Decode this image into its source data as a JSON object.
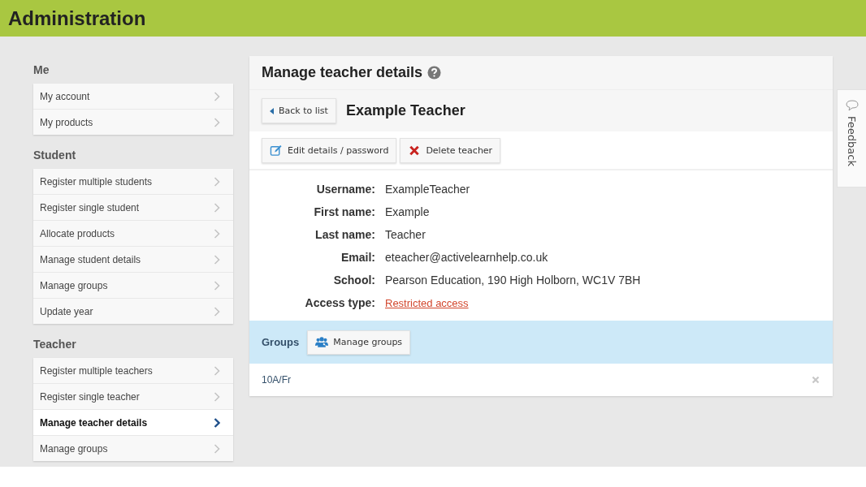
{
  "header": {
    "title": "Administration"
  },
  "sidebar": {
    "sections": [
      {
        "title": "Me",
        "items": [
          {
            "label": "My account",
            "selected": false
          },
          {
            "label": "My products",
            "selected": false
          }
        ]
      },
      {
        "title": "Student",
        "items": [
          {
            "label": "Register multiple students",
            "selected": false
          },
          {
            "label": "Register single student",
            "selected": false
          },
          {
            "label": "Allocate products",
            "selected": false
          },
          {
            "label": "Manage student details",
            "selected": false
          },
          {
            "label": "Manage groups",
            "selected": false
          },
          {
            "label": "Update year",
            "selected": false
          }
        ]
      },
      {
        "title": "Teacher",
        "items": [
          {
            "label": "Register multiple teachers",
            "selected": false
          },
          {
            "label": "Register single teacher",
            "selected": false
          },
          {
            "label": "Manage teacher details",
            "selected": true
          },
          {
            "label": "Manage groups",
            "selected": false
          }
        ]
      }
    ]
  },
  "panel": {
    "title": "Manage teacher details",
    "back_button": "Back to list",
    "teacher_name": "Example Teacher",
    "actions": [
      {
        "kind": "edit",
        "label": "Edit details / password"
      },
      {
        "kind": "delete",
        "label": "Delete teacher"
      }
    ],
    "details": [
      {
        "label": "Username:",
        "value": "ExampleTeacher",
        "kind": "text"
      },
      {
        "label": "First name:",
        "value": "Example",
        "kind": "text"
      },
      {
        "label": "Last name:",
        "value": "Teacher",
        "kind": "text"
      },
      {
        "label": "Email:",
        "value": "eteacher@activelearnhelp.co.uk",
        "kind": "text"
      },
      {
        "label": "School:",
        "value": "Pearson Education, 190 High Holborn, WC1V 7BH",
        "kind": "text"
      },
      {
        "label": "Access type:",
        "value": "Restricted access",
        "kind": "link"
      }
    ],
    "groups": {
      "title": "Groups",
      "button": "Manage groups",
      "items": [
        "10A/Fr"
      ]
    }
  },
  "feedback": {
    "label": "Feedback"
  }
}
